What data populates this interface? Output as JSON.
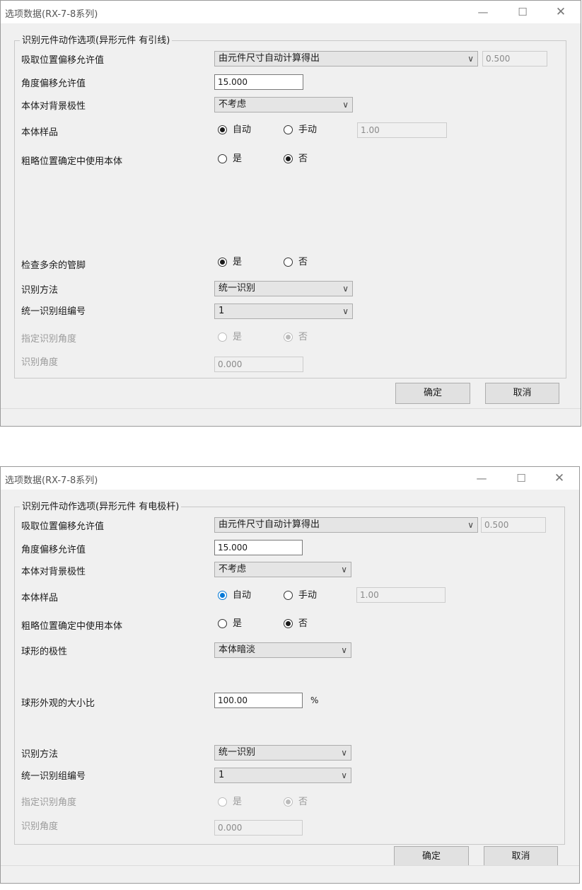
{
  "dialog1": {
    "title": "选项数据(RX-7-8系列)",
    "group_title": "识别元件动作选项(异形元件 有引线)",
    "pickup_offset": {
      "label": "吸取位置偏移允许值",
      "combo": "由元件尺寸自动计算得出",
      "value": "0.500"
    },
    "angle_offset": {
      "label": "角度偏移允许值",
      "value": "15.000"
    },
    "body_polarity": {
      "label": "本体对背景极性",
      "combo": "不考虑"
    },
    "body_sample": {
      "label": "本体样品",
      "auto": "自动",
      "manual": "手动",
      "value": "1.00"
    },
    "rough_pos": {
      "label": "粗略位置确定中使用本体",
      "yes": "是",
      "no": "否"
    },
    "check_extra_pins": {
      "label": "检查多余的管脚",
      "yes": "是",
      "no": "否"
    },
    "recog_method": {
      "label": "识别方法",
      "combo": "统一识别"
    },
    "recog_group": {
      "label": "统一识别组编号",
      "combo": "1"
    },
    "specify_angle": {
      "label": "指定识别角度",
      "yes": "是",
      "no": "否"
    },
    "recog_angle": {
      "label": "识别角度",
      "value": "0.000"
    },
    "ok": "确定",
    "cancel": "取消"
  },
  "dialog2": {
    "title": "选项数据(RX-7-8系列)",
    "group_title": "识别元件动作选项(异形元件 有电极杆)",
    "pickup_offset": {
      "label": "吸取位置偏移允许值",
      "combo": "由元件尺寸自动计算得出",
      "value": "0.500"
    },
    "angle_offset": {
      "label": "角度偏移允许值",
      "value": "15.000"
    },
    "body_polarity": {
      "label": "本体对背景极性",
      "combo": "不考虑"
    },
    "body_sample": {
      "label": "本体样品",
      "auto": "自动",
      "manual": "手动",
      "value": "1.00"
    },
    "rough_pos": {
      "label": "粗略位置确定中使用本体",
      "yes": "是",
      "no": "否"
    },
    "ball_polarity": {
      "label": "球形的极性",
      "combo": "本体暗淡"
    },
    "ball_ratio": {
      "label": "球形外观的大小比",
      "value": "100.00",
      "unit": "%"
    },
    "recog_method": {
      "label": "识别方法",
      "combo": "统一识别"
    },
    "recog_group": {
      "label": "统一识别组编号",
      "combo": "1"
    },
    "specify_angle": {
      "label": "指定识别角度",
      "yes": "是",
      "no": "否"
    },
    "recog_angle": {
      "label": "识别角度",
      "value": "0.000"
    },
    "ok": "确定",
    "cancel": "取消"
  },
  "window_buttons": {
    "minimize": "—",
    "maximize": "☐",
    "close": "✕"
  },
  "combo_arrow": "∨",
  "icons": [
    "minimize-icon",
    "maximize-icon",
    "close-icon",
    "chevron-down-icon"
  ]
}
